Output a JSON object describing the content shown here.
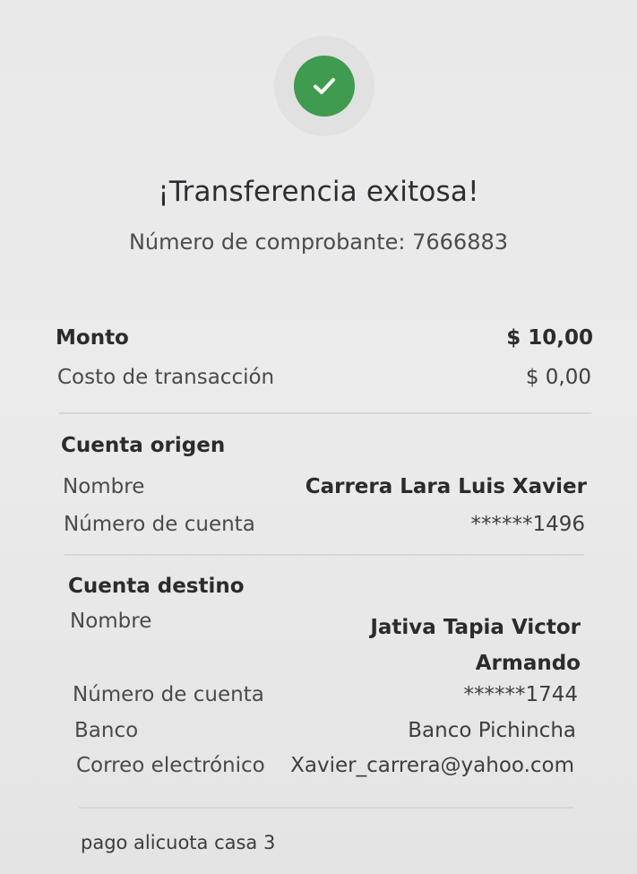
{
  "header": {
    "title": "¡Transferencia exitosa!",
    "receipt": "Número de comprobante: 7666883",
    "success_icon": "check-icon",
    "accent_color": "#3f9b4f"
  },
  "summary": {
    "amount_label": "Monto",
    "amount_value": "$ 10,00",
    "fee_label": "Costo de transacción",
    "fee_value": "$ 0,00"
  },
  "origin": {
    "title": "Cuenta origen",
    "name_label": "Nombre",
    "name_value": "Carrera Lara Luis Xavier",
    "account_label": "Número de cuenta",
    "account_value": "******1496"
  },
  "destination": {
    "title": "Cuenta destino",
    "name_label": "Nombre",
    "name_value": "Jativa Tapia Victor Armando",
    "account_label": "Número de cuenta",
    "account_value": "******1744",
    "bank_label": "Banco",
    "bank_value": "Banco Pichincha",
    "email_label": "Correo electrónico",
    "email_value": "Xavier_carrera@yahoo.com"
  },
  "note": "pago alicuota casa 3"
}
